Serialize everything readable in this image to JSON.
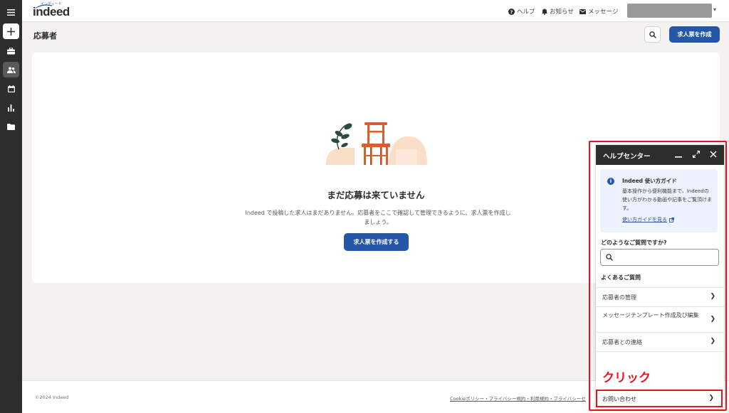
{
  "brand": {
    "logo": "indeed",
    "logo_ruby": "インディード",
    "accent": "#2557a7",
    "annotation_color": "#e8141d"
  },
  "nav": {
    "items": [
      {
        "icon": "menu-icon"
      },
      {
        "icon": "plus-icon"
      },
      {
        "icon": "briefcase-icon"
      },
      {
        "icon": "people-icon",
        "active": true
      },
      {
        "icon": "calendar-icon"
      },
      {
        "icon": "bar-chart-icon"
      },
      {
        "icon": "folder-icon"
      }
    ]
  },
  "topbar": {
    "help": "ヘルプ",
    "notifications": "お知らせ",
    "messages": "メッセージ"
  },
  "page": {
    "title": "応募者",
    "create_button": "求人票を作成"
  },
  "empty_state": {
    "title": "まだ応募は来ていません",
    "description": "Indeed で投稿した求人はまだありません。応募者をここで確認して管理できるように、求人票を作成しましょう。",
    "create_button": "求人票を作成する"
  },
  "footer": {
    "copyright": "©2024 Indeed",
    "links": "Cookieポリシー・プライバシー規約・利用規約・プライバシーセ"
  },
  "help_center": {
    "title": "ヘルプセンター",
    "guide": {
      "title": "Indeed 使い方ガイド",
      "text": "基本操作から便利機能まで、Indeedの使い方がわかる動画や記事をご覧頂けます。",
      "link": "使い方ガイドを見る"
    },
    "search_label": "どのようなご質問ですか?",
    "search_placeholder": "",
    "faq_label": "よくあるご質問",
    "faq_items": [
      {
        "label": "応募者の管理"
      },
      {
        "label": "メッセージテンプレート作成及び編集"
      },
      {
        "label": "応募者との連絡"
      }
    ],
    "contact": "お問い合わせ"
  },
  "annotation": {
    "text": "クリック"
  }
}
